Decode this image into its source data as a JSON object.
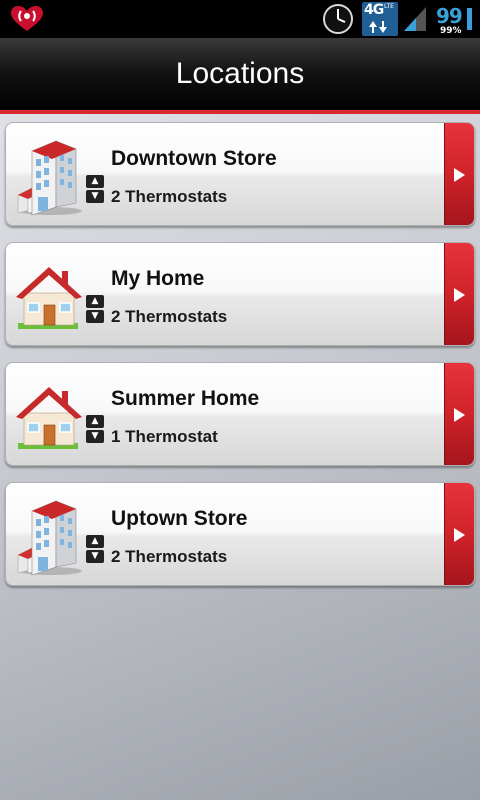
{
  "status_bar": {
    "network_label": "4G",
    "network_sub": "LTE",
    "battery_level": "99",
    "battery_percent": "99%"
  },
  "header": {
    "title": "Locations"
  },
  "colors": {
    "accent": "#d62a30",
    "arrow_red": "#cf2229",
    "header_bg": "#000000"
  },
  "locations": [
    {
      "name": "Downtown Store",
      "count": "2 Thermostats",
      "icon": "building-icon"
    },
    {
      "name": "My Home",
      "count": "2 Thermostats",
      "icon": "house-icon"
    },
    {
      "name": "Summer Home",
      "count": "1 Thermostat",
      "icon": "house-icon"
    },
    {
      "name": "Uptown Store",
      "count": "2 Thermostats",
      "icon": "building-icon"
    }
  ]
}
